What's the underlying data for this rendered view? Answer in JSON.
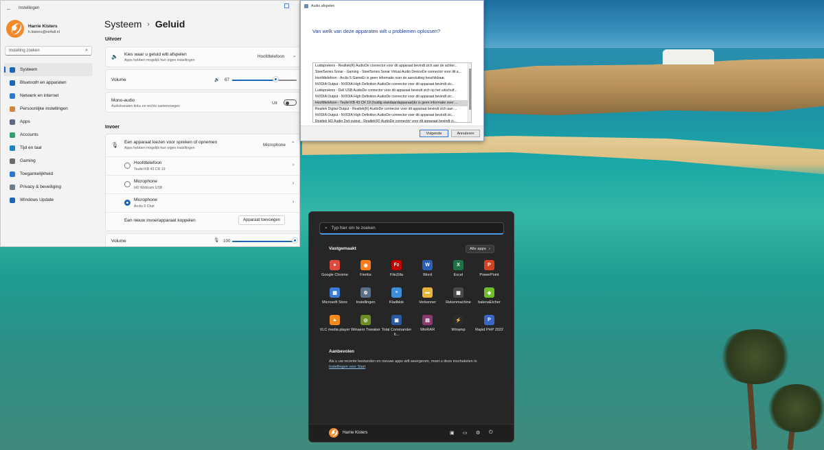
{
  "settings": {
    "window_title": "Instellingen",
    "user": {
      "name": "Harrie Kisters",
      "email": "h.kisters@xs4all.nl"
    },
    "search_placeholder": "Instelling zoeken",
    "nav": [
      {
        "label": "Systeem",
        "icon": "monitor-icon",
        "color": "#1a66b8",
        "active": true
      },
      {
        "label": "Bluetooth en apparaten",
        "icon": "bluetooth-icon",
        "color": "#1a66b8"
      },
      {
        "label": "Netwerk en internet",
        "icon": "wifi-icon",
        "color": "#2b78d0"
      },
      {
        "label": "Persoonlijke instellingen",
        "icon": "brush-icon",
        "color": "#d0873a"
      },
      {
        "label": "Apps",
        "icon": "apps-icon",
        "color": "#5a6a86"
      },
      {
        "label": "Accounts",
        "icon": "person-icon",
        "color": "#2fa06a"
      },
      {
        "label": "Tijd en taal",
        "icon": "globe-icon",
        "color": "#1a86c8"
      },
      {
        "label": "Gaming",
        "icon": "gamepad-icon",
        "color": "#6a6a6a"
      },
      {
        "label": "Toegankelijkheid",
        "icon": "accessibility-icon",
        "color": "#2b78d0"
      },
      {
        "label": "Privacy & beveiliging",
        "icon": "shield-icon",
        "color": "#6b7b8c"
      },
      {
        "label": "Windows Update",
        "icon": "update-icon",
        "color": "#1a66b8"
      }
    ],
    "breadcrumb": {
      "parent": "Systeem",
      "current": "Geluid"
    },
    "output": {
      "heading": "Uitvoer",
      "choose_title": "Kies waar u geluid wilt afspelen",
      "choose_sub": "Apps hebben mogelijk hun eigen instellingen",
      "choose_value": "Hoofdtelefoon",
      "volume_label": "Volume",
      "volume_value": "67",
      "volume_level": 0.67,
      "mono_title": "Mono-audio",
      "mono_sub": "Audiokanalen links en rechts samenvoegen",
      "mono_state": "Uit"
    },
    "input": {
      "heading": "Invoer",
      "choose_title": "Een apparaat kiezen voor spreken of opnemen",
      "choose_sub": "Apps hebben mogelijk hun eigen instellingen",
      "choose_value": "Microphone",
      "devices": [
        {
          "name": "Hoofdtelefoon",
          "detail": "Teufel KB 43 CR 19",
          "selected": false
        },
        {
          "name": "Microphone",
          "detail": "HD Webcam USB",
          "selected": false
        },
        {
          "name": "Microphone",
          "detail": "Arctis 5 Chat",
          "selected": true
        }
      ],
      "pair_label": "Een nieuw invoerapparaat koppelen",
      "pair_button": "Apparaat toevoegen",
      "volume_label": "Volume",
      "volume_value": "100",
      "volume_level": 1.0
    }
  },
  "audio_dialog": {
    "title": "Audio afspelen",
    "question": "Van welk van deze apparaten wilt u problemen oplossen?",
    "devices": [
      "Luidsprekers - Realtek(R) AudioDe connector voor dit apparaat bevindt zich aan de achter...",
      "SteelSeries Sonar - Gaming - SteelSeries Sonar Virtual Audio DeviceDe connector voor dit a...",
      "Hoofdtelefoon - Arctis 5 GameEr is geen informatie over de aansluiting beschikbaar.",
      "NVIDIA Output - NVIDIA High Definition AudioDe connector voor dit apparaat bevindt zic...",
      "Luidsprekers - Dell USB AudioDe connector voor dit apparaat bevindt zich op het uitschuif...",
      "NVIDIA Output - NVIDIA High Definition AudioDe connector voor dit apparaat bevindt zic...",
      "Hoofdtelefoon - Teufel KB 43 CR 19 (huidig standaardapparaat)Er is geen informatie over ...",
      "Realtek Digital Output - Realtek(R) AudioDe connector voor dit apparaat bevindt zich aan ...",
      "NVIDIA Output - NVIDIA High Definition AudioDe connector voor dit apparaat bevindt zic...",
      "Realtek HD Audio 2nd output - Realtek(R) AudioDe connector voor dit apparaat bevindt zi..."
    ],
    "selected_index": 6,
    "next_button": "Volgende",
    "cancel_button": "Annuleren"
  },
  "start_menu": {
    "search_placeholder": "Typ hier om te zoeken",
    "pinned_title": "Vastgemaakt",
    "all_apps": "Alle apps",
    "apps": [
      {
        "label": "Google Chrome",
        "icon": "chrome-icon",
        "color": "#dd4b3e",
        "glyph": "●"
      },
      {
        "label": "Firefox",
        "icon": "firefox-icon",
        "color": "#ff7a18",
        "glyph": "◉"
      },
      {
        "label": "FileZilla",
        "icon": "filezilla-icon",
        "color": "#bf0000",
        "glyph": "Fz"
      },
      {
        "label": "Word",
        "icon": "word-icon",
        "color": "#2b5fb4",
        "glyph": "W"
      },
      {
        "label": "Excel",
        "icon": "excel-icon",
        "color": "#1e7145",
        "glyph": "X"
      },
      {
        "label": "PowerPoint",
        "icon": "powerpoint-icon",
        "color": "#d04423",
        "glyph": "P"
      },
      {
        "label": "Microsoft Store",
        "icon": "store-icon",
        "color": "#3a7bd5",
        "glyph": "▦"
      },
      {
        "label": "Instellingen",
        "icon": "settings-gear-icon",
        "color": "#5a6f8a",
        "glyph": "⚙"
      },
      {
        "label": "Kladblok",
        "icon": "notepad-icon",
        "color": "#3c8fd8",
        "glyph": "≡"
      },
      {
        "label": "Verkenner",
        "icon": "folder-icon",
        "color": "#e8b53a",
        "glyph": "▬"
      },
      {
        "label": "Rekenmachine",
        "icon": "calculator-icon",
        "color": "#4a4a4a",
        "glyph": "▦"
      },
      {
        "label": "balenaEtcher",
        "icon": "etcher-icon",
        "color": "#6fbf2a",
        "glyph": "◆"
      },
      {
        "label": "VLC media player",
        "icon": "vlc-icon",
        "color": "#f28a1d",
        "glyph": "▲"
      },
      {
        "label": "Winaero Tweaker",
        "icon": "winaero-icon",
        "color": "#6b8e23",
        "glyph": "◎"
      },
      {
        "label": "Total Commander 6...",
        "icon": "totalcommander-icon",
        "color": "#2c5aa0",
        "glyph": "▣"
      },
      {
        "label": "WinRAR",
        "icon": "winrar-icon",
        "color": "#8a3a6e",
        "glyph": "▤"
      },
      {
        "label": "Winamp",
        "icon": "winamp-icon",
        "color": "#2b2b2b",
        "glyph": "⚡"
      },
      {
        "label": "Rapid PHP 2022",
        "icon": "rapidphp-icon",
        "color": "#3a66c4",
        "glyph": "P"
      }
    ],
    "recommended_title": "Aanbevolen",
    "recommended_text": "Als u uw recente bestanden en nieuwe apps wilt weergeven, moet u deze inschakelen in",
    "recommended_link": "Instellingen voor Start",
    "user_name": "Harrie Kisters"
  }
}
